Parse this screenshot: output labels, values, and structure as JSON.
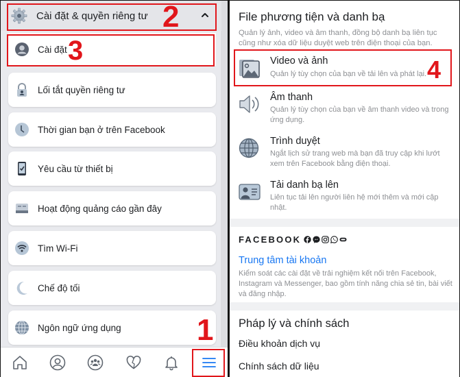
{
  "left_panel": {
    "section_header": {
      "icon": "gear-icon",
      "title": "Cài đặt & quyền riêng tư",
      "chevron": "chevron-up-icon"
    },
    "menu_items": [
      {
        "icon": "user-circle-icon",
        "label": "Cài đặt"
      },
      {
        "icon": "lock-icon",
        "label": "Lối tắt quyền riêng tư"
      },
      {
        "icon": "clock-icon",
        "label": "Thời gian bạn ở trên Facebook"
      },
      {
        "icon": "device-icon",
        "label": "Yêu cầu từ thiết bị"
      },
      {
        "icon": "ad-activity-icon",
        "label": "Hoạt động quảng cáo gần đây"
      },
      {
        "icon": "wifi-icon",
        "label": "Tìm Wi-Fi"
      },
      {
        "icon": "moon-icon",
        "label": "Chế độ tối"
      },
      {
        "icon": "globe-icon",
        "label": "Ngôn ngữ ứng dụng"
      }
    ],
    "bottom_nav": [
      {
        "icon": "home-icon",
        "active": false
      },
      {
        "icon": "profile-icon",
        "active": false
      },
      {
        "icon": "groups-icon",
        "active": false
      },
      {
        "icon": "dating-heart-icon",
        "active": false
      },
      {
        "icon": "bell-icon",
        "active": false
      },
      {
        "icon": "menu-icon",
        "active": true
      }
    ]
  },
  "right_panel": {
    "section": {
      "title": "File phương tiện và danh bạ",
      "subtitle": "Quản lý ảnh, video và âm thanh, đồng bộ danh bạ liên tục cũng như xóa dữ liệu duyệt web trên điện thoại của bạn."
    },
    "items": [
      {
        "icon": "photo-video-icon",
        "label": "Video và ảnh",
        "description": "Quản lý tùy chọn của bạn về tải lên và phát lại."
      },
      {
        "icon": "speaker-icon",
        "label": "Âm thanh",
        "description": "Quản lý tùy chọn của bạn về âm thanh video và trong ứng dụng."
      },
      {
        "icon": "globe-icon",
        "label": "Trình duyệt",
        "description": "Ngắt lịch sử trang web mà bạn đã truy cập khi lướt xem trên Facebook bằng điện thoại."
      },
      {
        "icon": "contact-card-icon",
        "label": "Tải danh bạ lên",
        "description": "Liên tục tải lên người liên hệ mới thêm và mới cập nhật."
      }
    ],
    "facebook_brand": {
      "wordmark": "FACEBOOK",
      "apps": [
        "facebook-icon",
        "messenger-icon",
        "instagram-icon",
        "whatsapp-icon",
        "oculus-icon"
      ]
    },
    "accounts_center": {
      "label": "Trung tâm tài khoản",
      "description": "Kiểm soát các cài đặt về trải nghiệm kết nối trên Facebook, Instagram và Messenger, bao gồm tính năng chia sẻ tin, bài viết và đăng nhập."
    },
    "legal": {
      "title": "Pháp lý và chính sách",
      "links": [
        "Điều khoản dịch vụ",
        "Chính sách dữ liệu"
      ]
    }
  },
  "annotations": [
    "1",
    "2",
    "3",
    "4"
  ],
  "colors": {
    "annotation_red": "#e1161b",
    "link_blue": "#1877f2",
    "active_nav_blue": "#1877f2"
  }
}
